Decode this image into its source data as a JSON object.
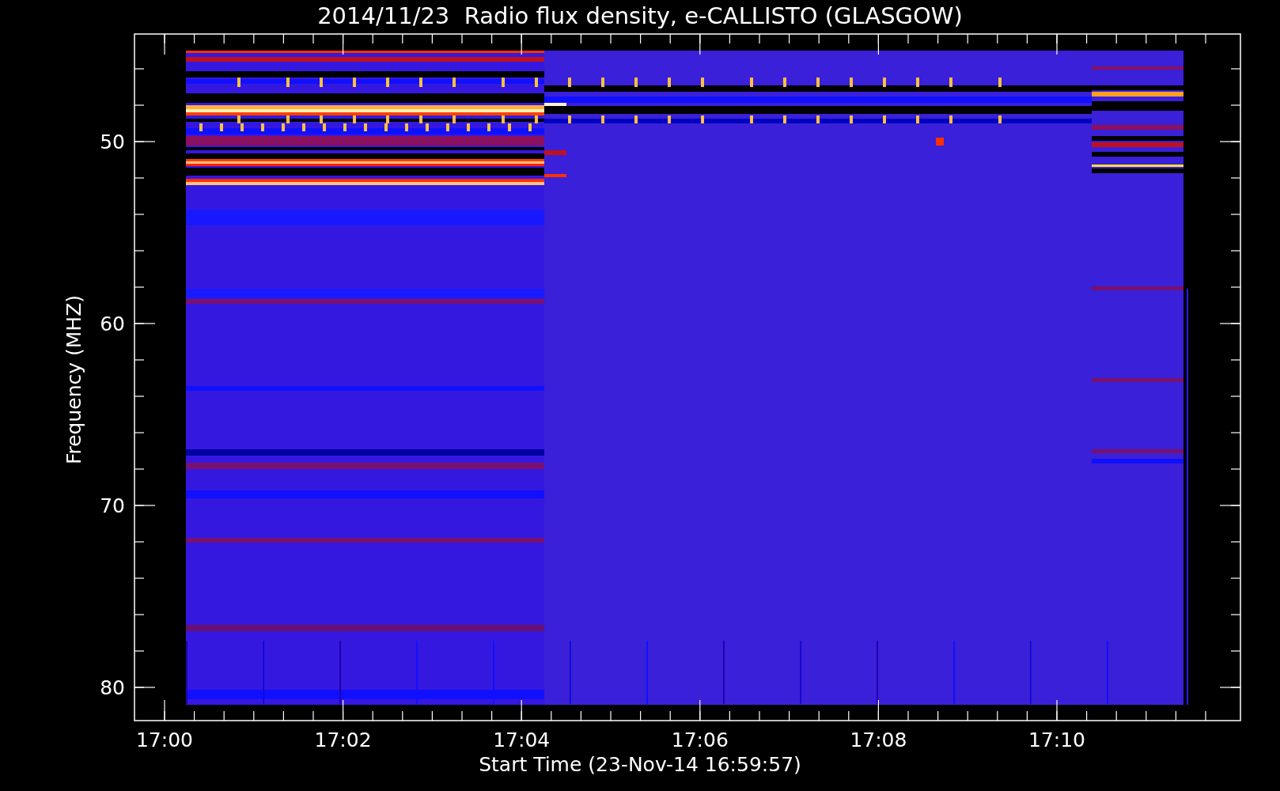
{
  "title": "2014/11/23  Radio flux density, e-CALLISTO (GLASGOW)",
  "y_axis": {
    "label": "Frequency (MHZ)",
    "ticks": [
      "50",
      "60",
      "70",
      "80"
    ]
  },
  "x_axis": {
    "label": "Start Time (23-Nov-14 16:59:57)",
    "ticks": [
      "17:00",
      "17:02",
      "17:04",
      "17:06",
      "17:08",
      "17:10"
    ]
  }
}
